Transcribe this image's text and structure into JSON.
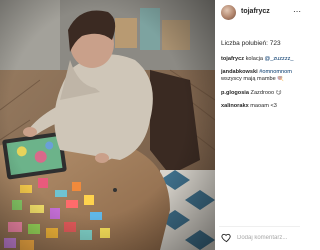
{
  "post": {
    "username": "tojafrycz",
    "likes_text": "Liczba polubień: 723",
    "comments": [
      {
        "user": "tojafrycz",
        "text": " kolacja ",
        "mention": "@_zuzzzz_"
      },
      {
        "user": "jandabkowski",
        "text": " ",
        "mention": "#omnomnom"
      },
      {
        "user": "",
        "text": "wszyscy mają mambe 🍭",
        "mention": ""
      },
      {
        "user": "p.glogosia",
        "text": " Zazdrooo 😏",
        "mention": ""
      },
      {
        "user": "xalinorakx",
        "text": " maoam <3",
        "mention": ""
      }
    ]
  },
  "comment_box": {
    "placeholder": "Dodaj komentarz..."
  },
  "icons": {
    "more": "more-options-icon",
    "heart": "heart-icon"
  }
}
